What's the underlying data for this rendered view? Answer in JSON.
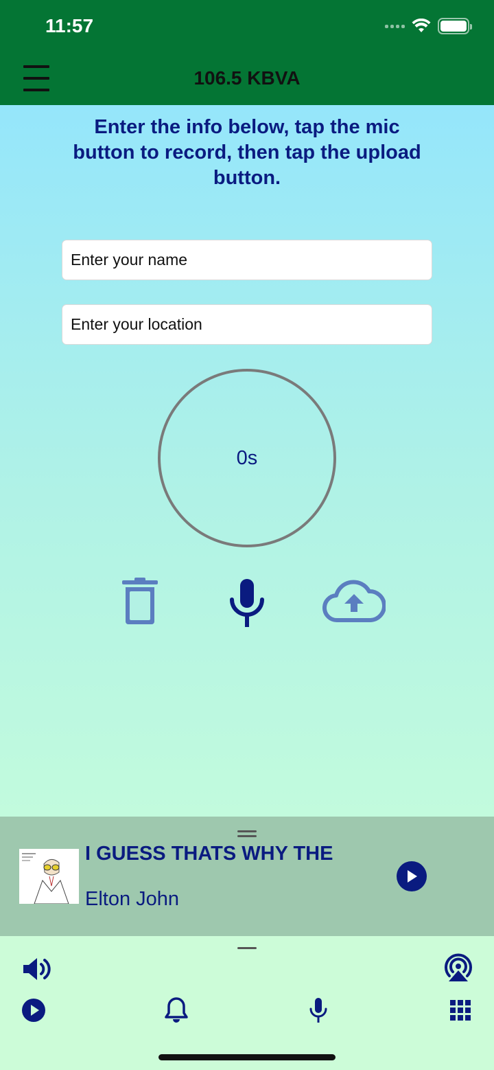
{
  "status_bar": {
    "time": "11:57"
  },
  "header": {
    "title": "106.5 KBVA",
    "menu_icon": "hamburger-menu-icon"
  },
  "main": {
    "instructions": "Enter the info below, tap the mic button to record, then tap the upload button.",
    "name_field": {
      "placeholder": "Enter your name",
      "value": ""
    },
    "location_field": {
      "placeholder": "Enter your location",
      "value": ""
    },
    "timer": "0s",
    "actions": {
      "delete_icon": "trash-icon",
      "record_icon": "microphone-icon",
      "upload_icon": "cloud-upload-icon"
    }
  },
  "now_playing": {
    "title": "I GUESS THATS WHY THE",
    "artist": "Elton John",
    "play_icon": "play-icon"
  },
  "bottom_bar": {
    "icons": [
      "volume-icon",
      "airplay-icon",
      "play-icon",
      "bell-icon",
      "microphone-icon",
      "grid-icon"
    ]
  },
  "colors": {
    "header": "#047534",
    "accent": "#0a1b80",
    "player_bg": "#9ec8ae",
    "bottom_bg": "#ccfcd8"
  }
}
